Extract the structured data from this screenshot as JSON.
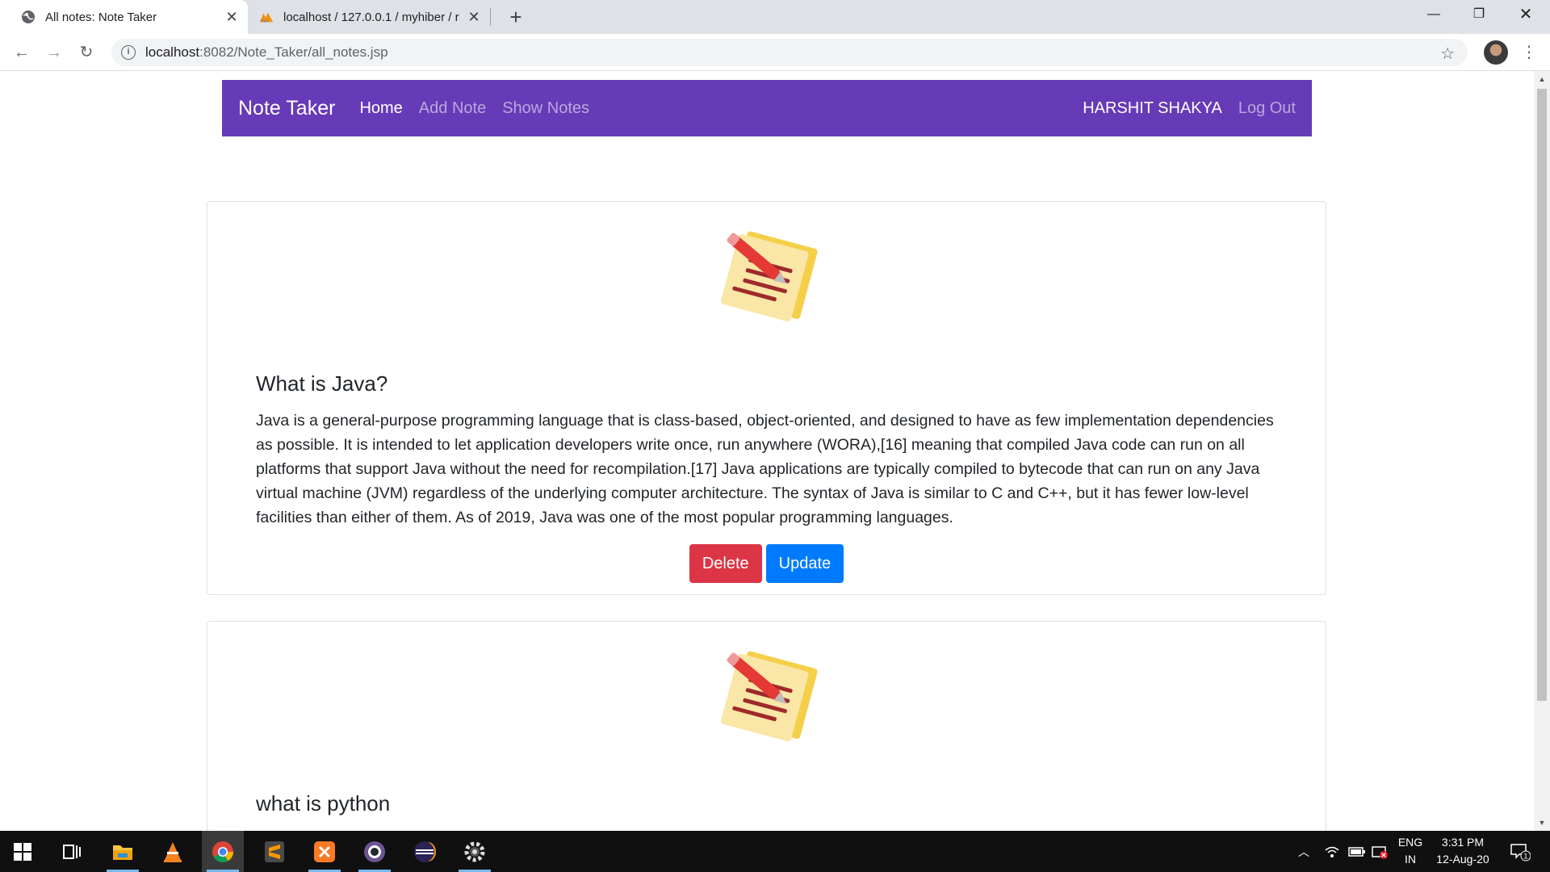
{
  "browser": {
    "tabs": [
      {
        "title": "All notes: Note Taker",
        "active": true
      },
      {
        "title": "localhost / 127.0.0.1 / myhiber / r",
        "active": false
      }
    ],
    "url_host": "localhost",
    "url_path": ":8082/Note_Taker/all_notes.jsp"
  },
  "navbar": {
    "brand": "Note Taker",
    "links": [
      {
        "label": "Home",
        "active": true
      },
      {
        "label": "Add Note",
        "active": false
      },
      {
        "label": "Show Notes",
        "active": false
      }
    ],
    "user": "HARSHIT SHAKYA",
    "logout": "Log Out",
    "color": "#673ab7"
  },
  "notes": [
    {
      "title": "What is Java?",
      "content": "Java is a general-purpose programming language that is class-based, object-oriented, and designed to have as few implementation dependencies as possible. It is intended to let application developers write once, run anywhere (WORA),[16] meaning that compiled Java code can run on all platforms that support Java without the need for recompilation.[17] Java applications are typically compiled to bytecode that can run on any Java virtual machine (JVM) regardless of the underlying computer architecture. The syntax of Java is similar to C and C++, but it has fewer low-level facilities than either of them. As of 2019, Java was one of the most popular programming languages.",
      "delete_label": "Delete",
      "update_label": "Update"
    },
    {
      "title": "what is python"
    }
  ],
  "taskbar": {
    "apps": [
      "windows-start",
      "task-view",
      "file-explorer",
      "vlc",
      "chrome",
      "sublime-text",
      "xampp",
      "github-desktop",
      "eclipse",
      "settings-gear"
    ],
    "language_line1": "ENG",
    "language_line2": "IN",
    "time": "3:31 PM",
    "date": "12-Aug-20",
    "notification_count": "1"
  }
}
